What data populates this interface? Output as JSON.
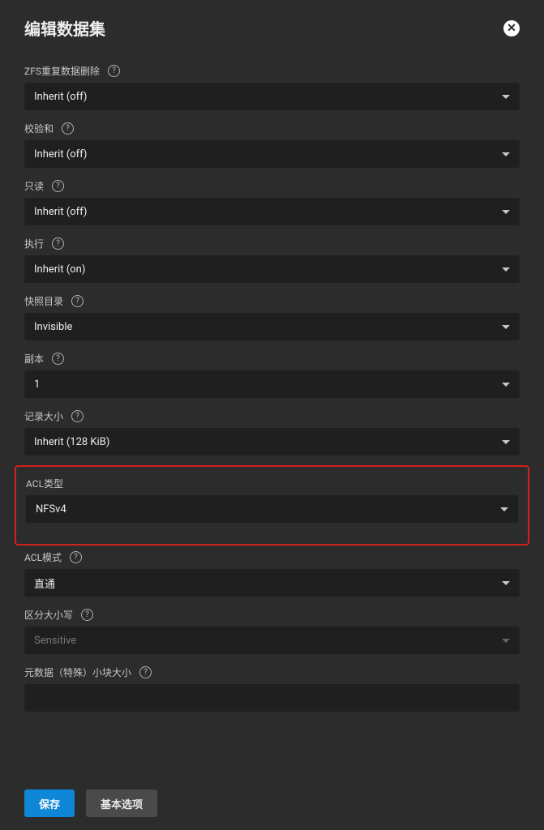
{
  "dialog": {
    "title": "编辑数据集",
    "close_glyph": "✕"
  },
  "fields": {
    "dedup": {
      "label": "ZFS重复数据删除",
      "value": "Inherit (off)"
    },
    "checksum": {
      "label": "校验和",
      "value": "Inherit (off)"
    },
    "readonly": {
      "label": "只读",
      "value": "Inherit (off)"
    },
    "exec": {
      "label": "执行",
      "value": "Inherit (on)"
    },
    "snapdir": {
      "label": "快照目录",
      "value": "Invisible"
    },
    "copies": {
      "label": "副本",
      "value": "1"
    },
    "recsize": {
      "label": "记录大小",
      "value": "Inherit (128 KiB)"
    },
    "acltype": {
      "label": "ACL类型",
      "value": "NFSv4"
    },
    "aclmode": {
      "label": "ACL模式",
      "value": "直通"
    },
    "casesens": {
      "label": "区分大小写",
      "value": "Sensitive"
    },
    "metaspec": {
      "label": "元数据（特殊）小块大小",
      "value": ""
    }
  },
  "icons": {
    "help_glyph": "?"
  },
  "buttons": {
    "save": "保存",
    "basic": "基本选项"
  }
}
